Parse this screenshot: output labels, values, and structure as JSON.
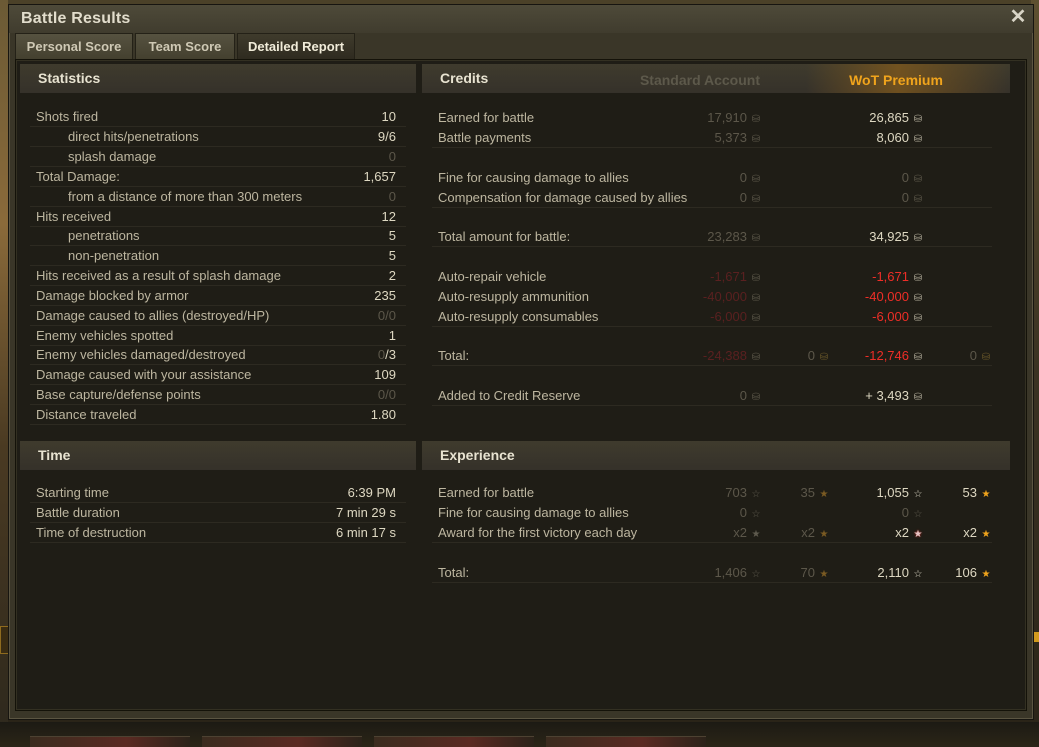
{
  "window": {
    "title": "Battle Results",
    "close": "✕"
  },
  "tabs": [
    {
      "label": "Personal Score",
      "active": false
    },
    {
      "label": "Team Score",
      "active": false
    },
    {
      "label": "Detailed Report",
      "active": true
    }
  ],
  "statistics": {
    "title": "Statistics",
    "rows": [
      {
        "label": "Shots fired",
        "value": "10"
      },
      {
        "label": "direct hits/penetrations",
        "value": "9/6"
      },
      {
        "label": "splash damage",
        "value": "0"
      },
      {
        "label": "Total Damage:",
        "value": "1,657"
      },
      {
        "label": "from a distance of more than 300 meters",
        "value": "0"
      },
      {
        "label": "Hits received",
        "value": "12"
      },
      {
        "label": "penetrations",
        "value": "5"
      },
      {
        "label": "non-penetration",
        "value": "5"
      },
      {
        "label": "Hits received as a result of splash damage",
        "value": "2"
      },
      {
        "label": "Damage blocked by armor",
        "value": "235"
      },
      {
        "label": "Damage caused to allies (destroyed/HP)",
        "value": "0/0"
      },
      {
        "label": "Enemy vehicles spotted",
        "value": "1"
      },
      {
        "label": "Enemy vehicles damaged/destroyed",
        "value_a": "0",
        "value_b": "/3"
      },
      {
        "label": "Damage caused with your assistance",
        "value": "109"
      },
      {
        "label": "Base capture/defense points",
        "value": "0/0"
      },
      {
        "label": "Distance traveled",
        "value": "1.80"
      }
    ]
  },
  "time": {
    "title": "Time",
    "rows": [
      {
        "label": "Starting time",
        "value": "6:39 PM"
      },
      {
        "label": "Battle duration",
        "value": "7 min 29 s"
      },
      {
        "label": "Time of destruction",
        "value": "6 min 17 s"
      }
    ]
  },
  "credits": {
    "title": "Credits",
    "standard_label": "Standard Account",
    "premium_label": "WoT Premium",
    "rows": [
      {
        "label": "Earned for battle",
        "std": "17,910",
        "prem": "26,865"
      },
      {
        "label": "Battle payments",
        "std": "5,373",
        "prem": "8,060"
      },
      {
        "label": "Fine for causing damage to allies",
        "std": "0",
        "prem": "0"
      },
      {
        "label": "Compensation for damage caused by allies",
        "std": "0",
        "prem": "0"
      },
      {
        "label": "Total amount for battle:",
        "std": "23,283",
        "prem": "34,925"
      },
      {
        "label": "Auto-repair vehicle",
        "std": "-1,671",
        "prem": "-1,671"
      },
      {
        "label": "Auto-resupply ammunition",
        "std": "-40,000",
        "prem": "-40,000"
      },
      {
        "label": "Auto-resupply consumables",
        "std": "-6,000",
        "prem": "-6,000"
      },
      {
        "label": "Total:",
        "std": "-24,388",
        "std_gold": "0",
        "prem": "-12,746",
        "prem_gold": "0"
      },
      {
        "label": "Added to Credit Reserve",
        "std": "0",
        "prem": "+ 3,493"
      }
    ]
  },
  "experience": {
    "title": "Experience",
    "rows": [
      {
        "label": "Earned for battle",
        "std": "703",
        "std_free": "35",
        "prem": "1,055",
        "prem_free": "53"
      },
      {
        "label": "Fine for causing damage to allies",
        "std": "0",
        "prem": "0"
      },
      {
        "label": "Award for the first victory each day",
        "std": "x2",
        "std_free": "x2",
        "prem": "x2",
        "prem_free": "x2"
      },
      {
        "label": "Total:",
        "std": "1,406",
        "std_free": "70",
        "prem": "2,110",
        "prem_free": "106"
      }
    ]
  },
  "icons": {
    "coin": "⛁",
    "gold": "⛁",
    "star": "☆",
    "star_filled": "★"
  },
  "colors": {
    "accent_premium": "#f0a41c",
    "negative": "#ee2e27",
    "panel": "#1f1d16",
    "header": "#3f3b2d"
  }
}
